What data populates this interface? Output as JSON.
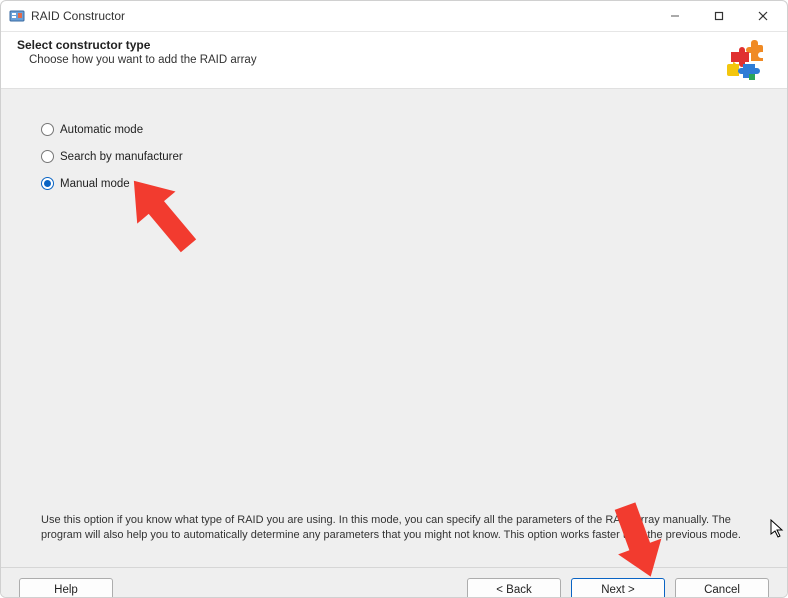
{
  "window": {
    "title": "RAID Constructor"
  },
  "header": {
    "title": "Select constructor type",
    "subtitle": "Choose how you want to add the RAID array"
  },
  "options": {
    "automatic": "Automatic mode",
    "manufacturer": "Search by manufacturer",
    "manual": "Manual mode",
    "selected": "manual"
  },
  "description": "Use this option if you know what type of RAID you are using. In this mode, you can specify all the parameters of the RAID array manually. The program will also help you to automatically determine any parameters that you might not know. This option works faster than the previous mode.",
  "buttons": {
    "help": "Help",
    "back": "< Back",
    "next": "Next >",
    "cancel": "Cancel"
  }
}
